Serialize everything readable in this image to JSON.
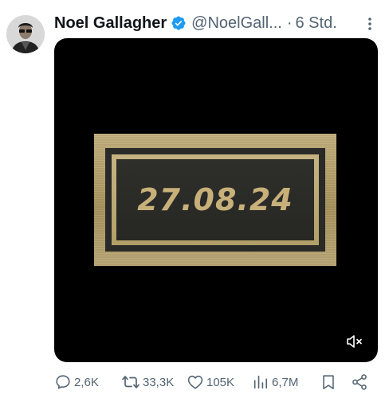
{
  "author": {
    "name": "Noel Gallagher",
    "handle": "@NoelGall...",
    "separator": "·",
    "time": "6 Std."
  },
  "media": {
    "plate_text": "27.08.24"
  },
  "actions": {
    "replies": "2,6K",
    "retweets": "33,3K",
    "likes": "105K",
    "views": "6,7M"
  },
  "colors": {
    "text": "#0f1419",
    "secondary": "#536471",
    "verified": "#1d9bf0",
    "gold": "#c7b07a"
  },
  "icons": [
    "avatar",
    "verified-badge-icon",
    "more-options-icon",
    "mute-icon",
    "reply-icon",
    "retweet-icon",
    "like-icon",
    "views-icon",
    "bookmark-icon",
    "share-icon"
  ]
}
